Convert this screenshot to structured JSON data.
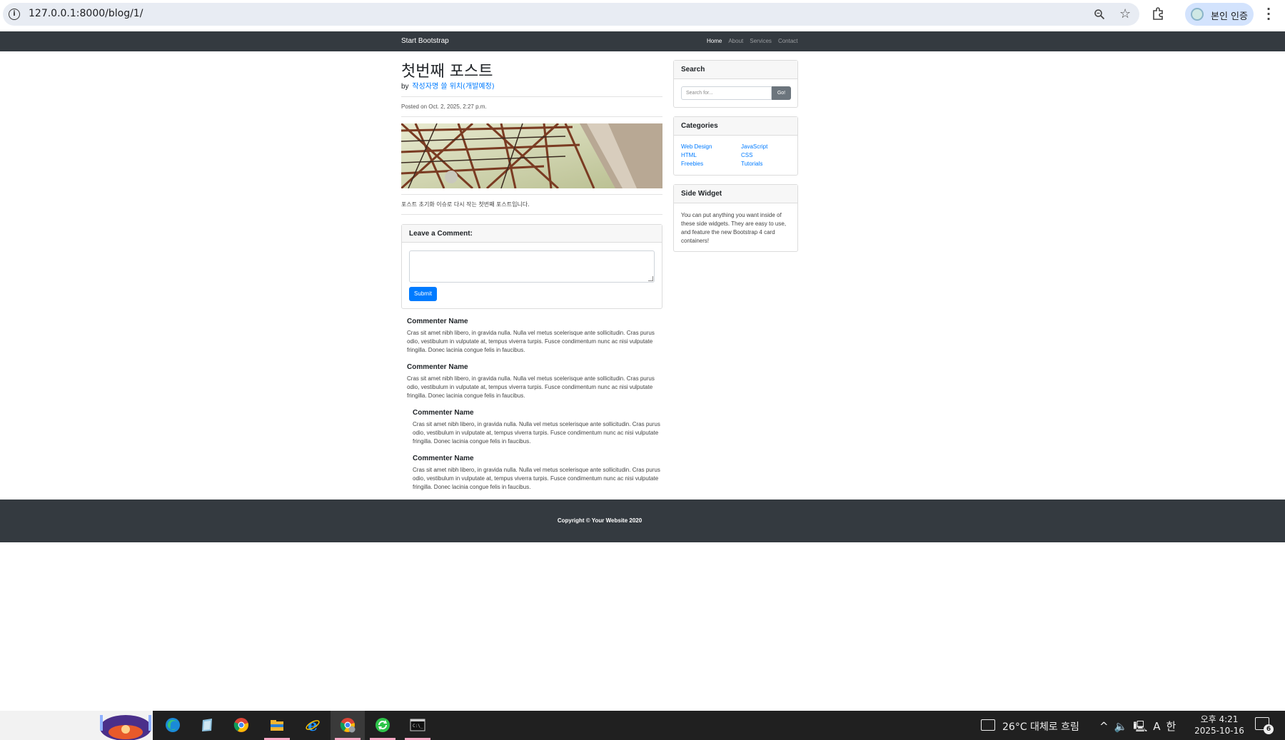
{
  "browser": {
    "url": "127.0.0.1:8000/blog/1/",
    "profile_label": "본인 인증",
    "icons": [
      "info-icon",
      "zoom-icon",
      "star-icon",
      "extensions-icon",
      "profile-avatar",
      "menu-kebab-icon"
    ]
  },
  "navbar": {
    "brand": "Start Bootstrap",
    "links": [
      "Home",
      "About",
      "Services",
      "Contact"
    ],
    "active": "Home"
  },
  "post": {
    "title": "첫번째 포스트",
    "by_prefix": "by",
    "author": "작성자명 쓸 위치(개발예정)",
    "posted": "Posted on Oct. 2, 2025, 2:27 p.m.",
    "body": "포스트 초기화 이슈로 다시 작는 첫번째 포스트입니다."
  },
  "comment_form": {
    "header": "Leave a Comment:",
    "submit_label": "Submit"
  },
  "comments": [
    {
      "name": "Commenter Name",
      "text": "Cras sit amet nibh libero, in gravida nulla. Nulla vel metus scelerisque ante sollicitudin. Cras purus odio, vestibulum in vulputate at, tempus viverra turpis. Fusce condimentum nunc ac nisi vulputate fringilla. Donec lacinia congue felis in faucibus."
    },
    {
      "name": "Commenter Name",
      "text": "Cras sit amet nibh libero, in gravida nulla. Nulla vel metus scelerisque ante sollicitudin. Cras purus odio, vestibulum in vulputate at, tempus viverra turpis. Fusce condimentum nunc ac nisi vulputate fringilla. Donec lacinia congue felis in faucibus."
    },
    {
      "name": "Commenter Name",
      "text": "Cras sit amet nibh libero, in gravida nulla. Nulla vel metus scelerisque ante sollicitudin. Cras purus odio, vestibulum in vulputate at, tempus viverra turpis. Fusce condimentum nunc ac nisi vulputate fringilla. Donec lacinia congue felis in faucibus."
    },
    {
      "name": "Commenter Name",
      "text": "Cras sit amet nibh libero, in gravida nulla. Nulla vel metus scelerisque ante sollicitudin. Cras purus odio, vestibulum in vulputate at, tempus viverra turpis. Fusce condimentum nunc ac nisi vulputate fringilla. Donec lacinia congue felis in faucibus."
    }
  ],
  "sidebar": {
    "search": {
      "header": "Search",
      "placeholder": "Search for...",
      "button": "Go!"
    },
    "categories": {
      "header": "Categories",
      "left": [
        "Web Design",
        "HTML",
        "Freebies"
      ],
      "right": [
        "JavaScript",
        "CSS",
        "Tutorials"
      ]
    },
    "side_widget": {
      "header": "Side Widget",
      "text": "You can put anything you want inside of these side widgets. They are easy to use, and feature the new Bootstrap 4 card containers!"
    }
  },
  "footer": {
    "text": "Copyright © Your Website 2020"
  },
  "taskbar": {
    "apps": [
      "edge",
      "notepad",
      "chrome",
      "file-explorer",
      "internet-explorer",
      "chrome-alt",
      "refresh-app",
      "terminal"
    ],
    "weather": "26°C  대체로 흐림",
    "tray_lang": "A",
    "tray_ime": "한",
    "time": "오후 4:21",
    "date": "2025-10-16",
    "notifications": "6"
  },
  "colors": {
    "dark": "#343a40",
    "link": "#007bff",
    "button_primary": "#007bff",
    "button_secondary": "#6c757d"
  }
}
